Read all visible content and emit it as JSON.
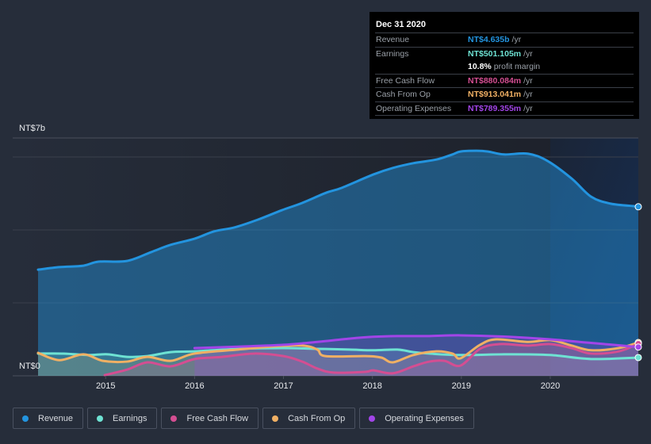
{
  "tooltip": {
    "date": "Dec 31 2020",
    "rows": [
      {
        "label": "Revenue",
        "value": "NT$4.635b",
        "unit": "/yr",
        "color": "#2394df"
      },
      {
        "label": "Earnings",
        "value": "NT$501.105m",
        "unit": "/yr",
        "color": "#6ee2d3"
      },
      {
        "label": "",
        "value": "10.8%",
        "unit": "profit margin",
        "color": "#ffffff"
      },
      {
        "label": "Free Cash Flow",
        "value": "NT$880.084m",
        "unit": "/yr",
        "color": "#d44e92"
      },
      {
        "label": "Cash From Op",
        "value": "NT$913.041m",
        "unit": "/yr",
        "color": "#f0b064"
      },
      {
        "label": "Operating Expenses",
        "value": "NT$789.355m",
        "unit": "/yr",
        "color": "#a245e8"
      }
    ]
  },
  "chart_data": {
    "type": "line",
    "title": "",
    "xlabel": "",
    "ylabel": "",
    "y_top_label": "NT$7b",
    "y_bottom_label": "NT$0",
    "ylim": [
      0,
      6.5
    ],
    "xlim": [
      2014.24,
      2020.99
    ],
    "grid": true,
    "x_ticks": [
      "2015",
      "2016",
      "2017",
      "2018",
      "2019",
      "2020"
    ],
    "x_tick_values": [
      2015,
      2016,
      2017,
      2018,
      2019,
      2020
    ],
    "highlight_from": 2020.0,
    "legend_position": "bottom-left",
    "units": "NT$ billions",
    "series": [
      {
        "name": "Revenue",
        "color": "#2394df",
        "fill": true,
        "x": [
          2014.24,
          2014.48,
          2014.75,
          2014.92,
          2015.24,
          2015.51,
          2015.73,
          2016.0,
          2016.22,
          2016.45,
          2016.71,
          2016.98,
          2017.21,
          2017.48,
          2017.65,
          2018.01,
          2018.23,
          2018.46,
          2018.72,
          2018.9,
          2018.99,
          2019.17,
          2019.3,
          2019.48,
          2019.75,
          2019.97,
          2020.24,
          2020.46,
          2020.68,
          2020.95,
          2020.99
        ],
        "values": [
          2.91,
          2.98,
          3.02,
          3.13,
          3.15,
          3.39,
          3.59,
          3.76,
          3.96,
          4.07,
          4.28,
          4.54,
          4.74,
          5.02,
          5.15,
          5.52,
          5.7,
          5.83,
          5.93,
          6.07,
          6.15,
          6.17,
          6.15,
          6.07,
          6.09,
          5.89,
          5.41,
          4.91,
          4.72,
          4.65,
          4.635
        ]
      },
      {
        "name": "Earnings",
        "color": "#6ee2d3",
        "fill": true,
        "x": [
          2014.24,
          2014.53,
          2014.8,
          2015.02,
          2015.24,
          2015.47,
          2015.73,
          2016.0,
          2016.49,
          2017.0,
          2017.38,
          2017.74,
          2018.01,
          2018.28,
          2018.46,
          2018.64,
          2018.99,
          2019.53,
          2020.0,
          2020.46,
          2020.99
        ],
        "values": [
          0.61,
          0.61,
          0.57,
          0.59,
          0.52,
          0.54,
          0.65,
          0.67,
          0.74,
          0.76,
          0.74,
          0.72,
          0.7,
          0.72,
          0.65,
          0.61,
          0.57,
          0.59,
          0.57,
          0.46,
          0.501
        ]
      },
      {
        "name": "Free Cash Flow",
        "color": "#d44e92",
        "fill": true,
        "x": [
          2014.99,
          2015.24,
          2015.47,
          2015.73,
          2016.0,
          2016.31,
          2016.67,
          2017.0,
          2017.21,
          2017.38,
          2017.56,
          2017.92,
          2018.01,
          2018.23,
          2018.46,
          2018.64,
          2018.81,
          2018.99,
          2019.21,
          2019.43,
          2019.75,
          2020.0,
          2020.24,
          2020.46,
          2020.77,
          2020.99
        ],
        "values": [
          0.02,
          0.17,
          0.37,
          0.26,
          0.46,
          0.52,
          0.61,
          0.54,
          0.39,
          0.2,
          0.09,
          0.11,
          0.15,
          0.07,
          0.26,
          0.39,
          0.41,
          0.28,
          0.74,
          0.87,
          0.83,
          0.87,
          0.76,
          0.61,
          0.67,
          0.88
        ]
      },
      {
        "name": "Cash From Op",
        "color": "#f0b064",
        "fill": true,
        "x": [
          2014.24,
          2014.48,
          2014.75,
          2014.97,
          2015.24,
          2015.47,
          2015.73,
          2016.0,
          2016.49,
          2016.85,
          2017.21,
          2017.38,
          2017.47,
          2017.92,
          2018.1,
          2018.23,
          2018.46,
          2018.72,
          2018.9,
          2018.99,
          2019.21,
          2019.39,
          2019.75,
          2020.0,
          2020.24,
          2020.46,
          2020.77,
          2020.99
        ],
        "values": [
          0.63,
          0.43,
          0.59,
          0.41,
          0.39,
          0.52,
          0.41,
          0.61,
          0.72,
          0.8,
          0.83,
          0.72,
          0.54,
          0.54,
          0.5,
          0.37,
          0.57,
          0.67,
          0.61,
          0.48,
          0.85,
          1.0,
          0.93,
          0.98,
          0.83,
          0.7,
          0.76,
          0.913
        ]
      },
      {
        "name": "Operating Expenses",
        "color": "#a245e8",
        "fill": true,
        "x": [
          2016.0,
          2016.49,
          2017.0,
          2017.38,
          2017.74,
          2018.01,
          2018.28,
          2018.64,
          2018.99,
          2019.53,
          2020.0,
          2020.42,
          2020.99
        ],
        "values": [
          0.76,
          0.8,
          0.85,
          0.93,
          1.02,
          1.07,
          1.09,
          1.09,
          1.11,
          1.07,
          1.0,
          0.91,
          0.789
        ]
      }
    ]
  },
  "legend": [
    {
      "label": "Revenue",
      "color": "#2394df"
    },
    {
      "label": "Earnings",
      "color": "#6ee2d3"
    },
    {
      "label": "Free Cash Flow",
      "color": "#d44e92"
    },
    {
      "label": "Cash From Op",
      "color": "#f0b064"
    },
    {
      "label": "Operating Expenses",
      "color": "#a245e8"
    }
  ]
}
